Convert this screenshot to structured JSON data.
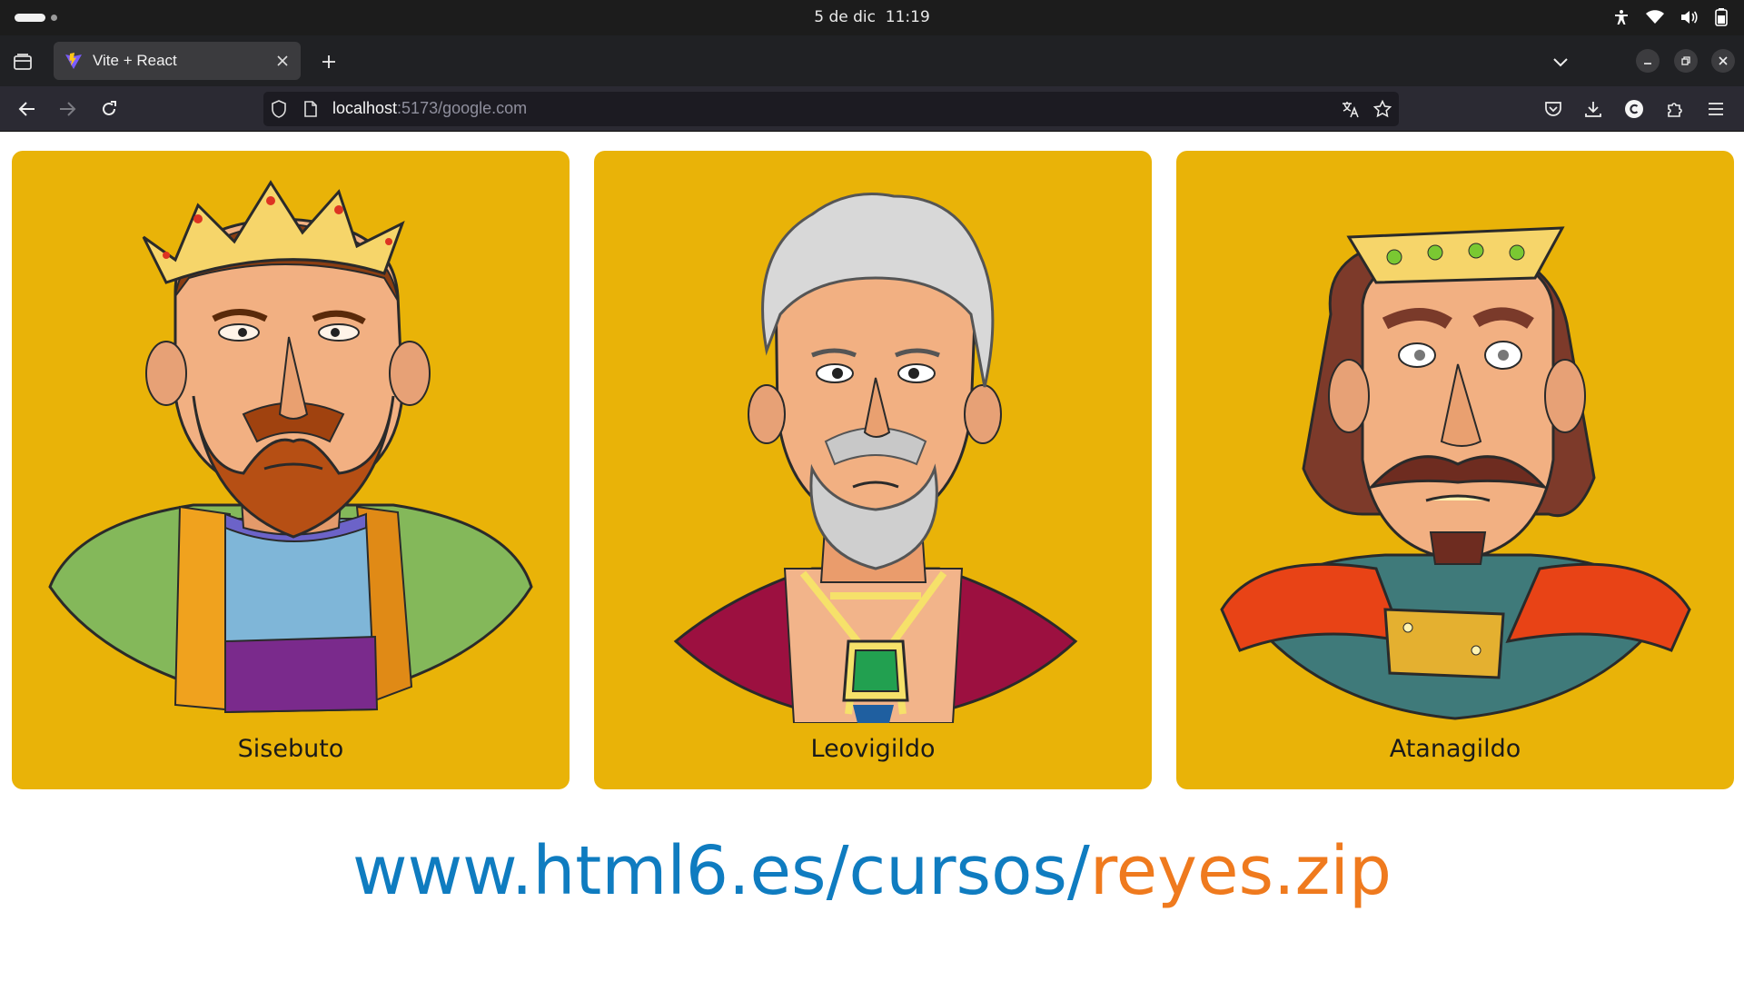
{
  "system_bar": {
    "date": "5 de dic",
    "time": "11:19",
    "icons": [
      "accessibility-icon",
      "wifi-icon",
      "volume-icon",
      "battery-icon"
    ]
  },
  "browser": {
    "tab": {
      "title": "Vite + React",
      "favicon": "vite-logo-icon"
    },
    "url": {
      "host": "localhost",
      "rest": ":5173/google.com"
    },
    "toolbar_icons": [
      "pocket-icon",
      "downloads-icon",
      "account-icon",
      "extensions-icon",
      "menu-icon"
    ]
  },
  "cards": [
    {
      "name": "Sisebuto"
    },
    {
      "name": "Leovigildo"
    },
    {
      "name": "Atanagildo"
    }
  ],
  "download_link": {
    "base": "www.html6.es/cursos/",
    "file": "reyes.zip"
  },
  "colors": {
    "card_background": "#e9b308",
    "link_blue": "#0f7cc0",
    "link_orange": "#ef7a1e"
  }
}
